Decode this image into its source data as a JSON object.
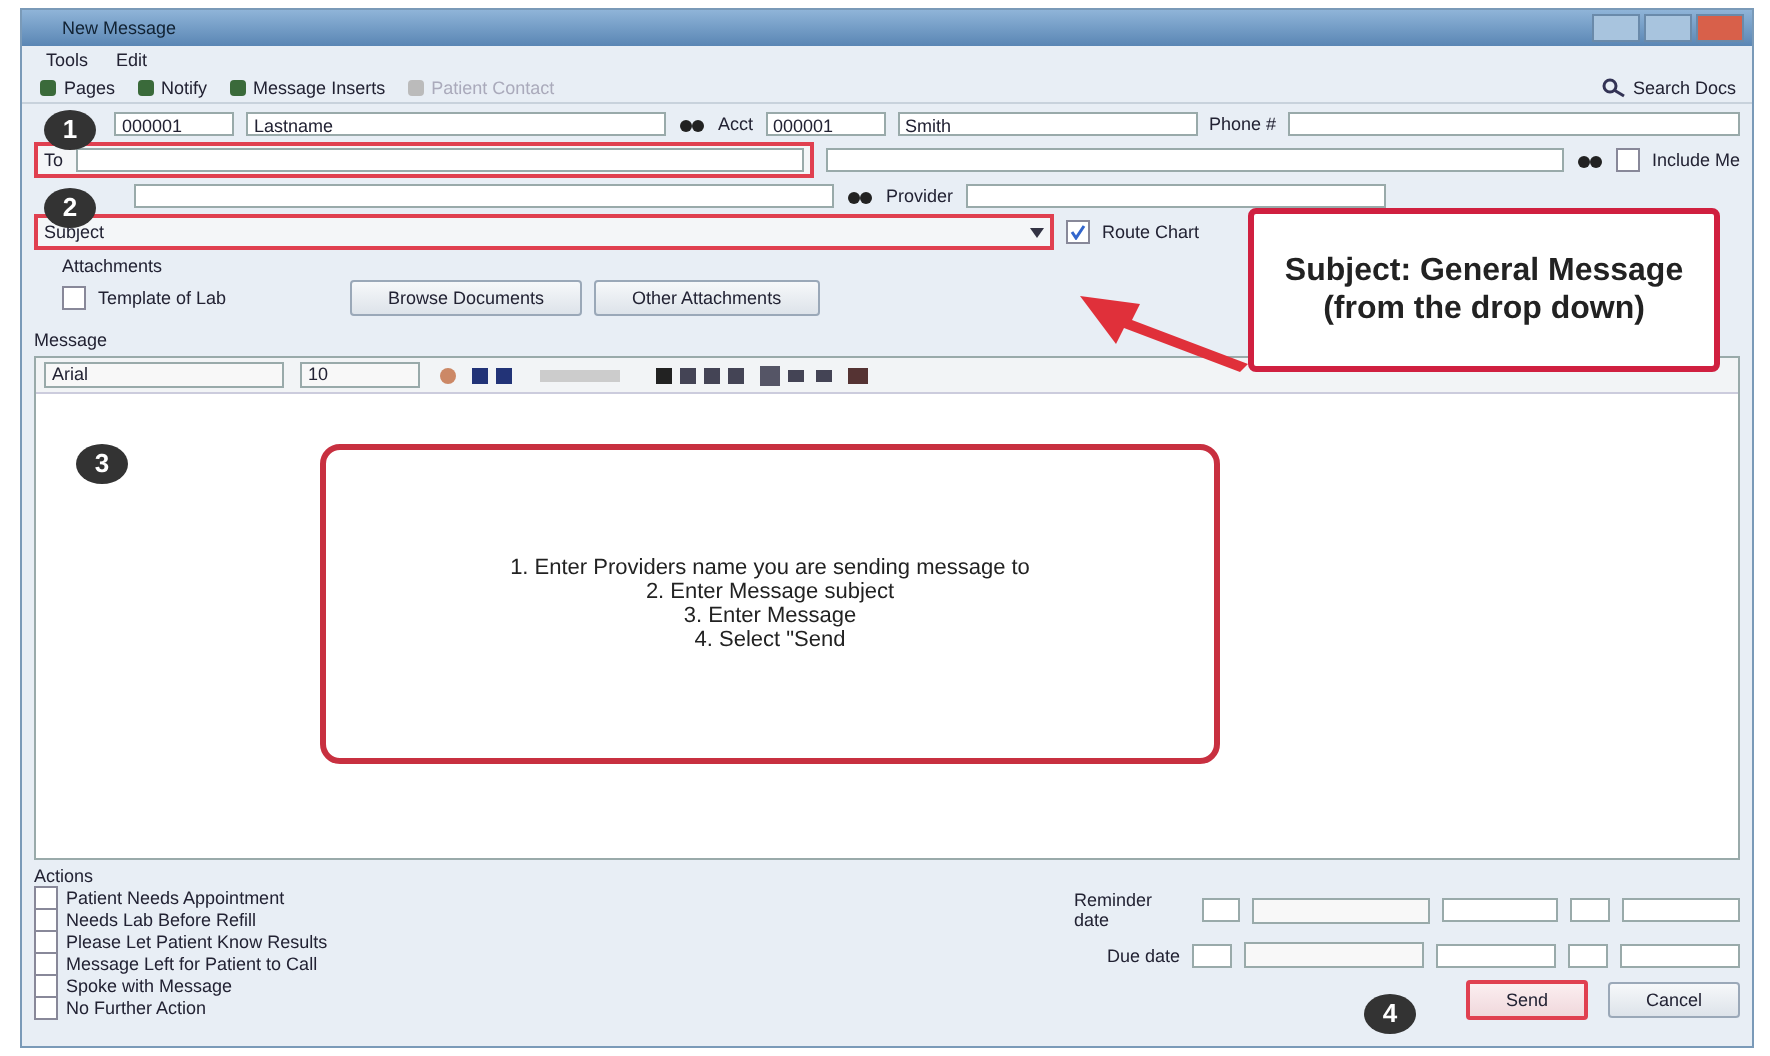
{
  "window": {
    "title": "New Message"
  },
  "menu": [
    "Tools",
    "Edit"
  ],
  "toolbar": [
    {
      "label": "Pages",
      "disabled": false
    },
    {
      "label": "Notify",
      "disabled": false
    },
    {
      "label": "Message Inserts",
      "disabled": false
    },
    {
      "label": "Patient Contact",
      "disabled": true
    }
  ],
  "toolbar_right": "Search Docs",
  "patient": {
    "id": "000001",
    "name": "Lastname",
    "account_label": "Acct",
    "account": "000001",
    "account_name": "Smith",
    "phone_label": "Phone #"
  },
  "to": {
    "label": "To",
    "include_label": "Include Me",
    "include_checked": false
  },
  "cc": {
    "provider_label": "Provider"
  },
  "subject": {
    "label": "Subject",
    "route_label": "Route Chart",
    "route_checked": true
  },
  "attachments": {
    "label": "Attachments",
    "template_label": "Template of Lab",
    "template_checked": false,
    "buttons": [
      "Browse Documents",
      "Other Attachments"
    ]
  },
  "message": {
    "label": "Message",
    "font": "Arial",
    "size": "10"
  },
  "actions": {
    "label": "Actions",
    "items": [
      {
        "label": "Patient Needs Appointment",
        "checked": false
      },
      {
        "label": "Needs Lab Before Refill",
        "checked": false
      },
      {
        "label": "Please Let Patient Know Results",
        "checked": false
      },
      {
        "label": "Message Left for Patient to Call",
        "checked": false
      },
      {
        "label": "Spoke with Message",
        "checked": false
      },
      {
        "label": "No Further Action",
        "checked": false
      }
    ]
  },
  "dates": [
    {
      "label": "Reminder date"
    },
    {
      "label": "Due date"
    }
  ],
  "buttons": [
    {
      "label": "Send",
      "highlighted": true
    },
    {
      "label": "Cancel",
      "highlighted": false
    }
  ],
  "steps": [
    "1",
    "2",
    "3",
    "4"
  ],
  "annotation": "Subject: General Message (from the drop down)",
  "instructions": [
    "1. Enter Providers name you are sending message to",
    "2. Enter Message subject",
    "3. Enter Message",
    "4. Select \"Send"
  ]
}
